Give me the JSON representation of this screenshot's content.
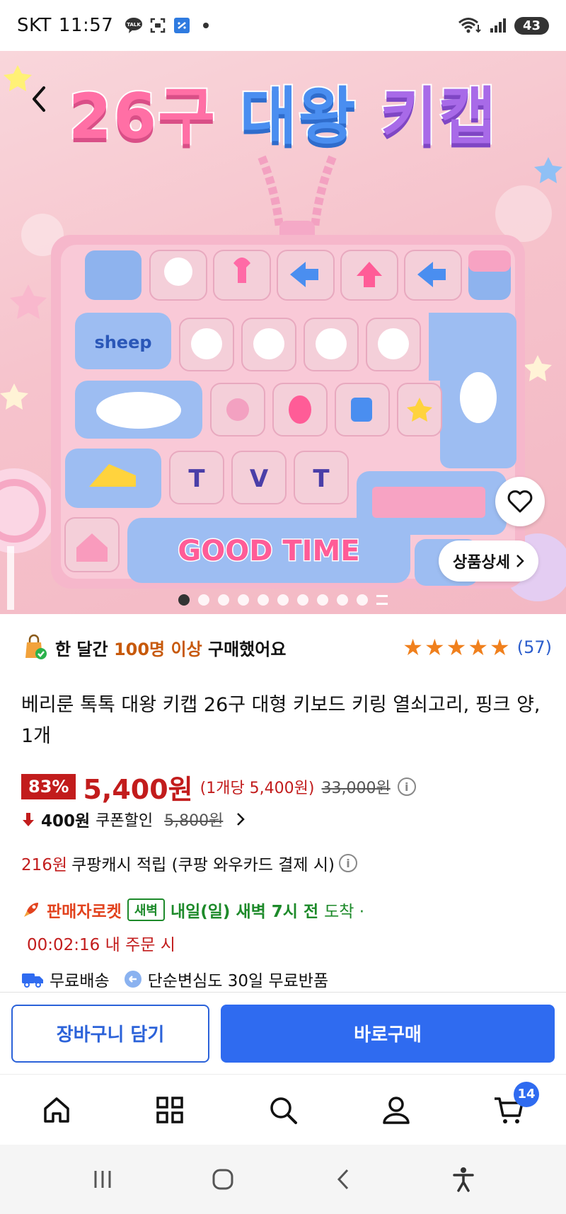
{
  "status_bar": {
    "carrier": "SKT",
    "time": "11:57",
    "talk_icon_text": "TALK",
    "battery": "43"
  },
  "hero": {
    "title_part1": "26구",
    "title_part2": "대왕",
    "title_part3": "키캡",
    "key_text_sheep": "sheep",
    "key_text_goodtime": "GOOD TIME",
    "key_letters": [
      "T",
      "V",
      "T"
    ],
    "detail_button_label": "상품상세",
    "image_count": 10,
    "current_image": 1
  },
  "social_proof": {
    "prefix": "한 달간 ",
    "highlight": "100명 이상",
    "suffix": " 구매했어요",
    "rating": 5,
    "review_count": "(57)"
  },
  "product": {
    "title": "베리룬 톡톡 대왕 키캡 26구 대형 키보드 키링 열쇠고리, 핑크 양, 1개"
  },
  "price": {
    "discount": "83%",
    "sale_price": "5,400원",
    "unit_price": "(1개당 5,400원)",
    "original_price": "33,000원"
  },
  "coupon": {
    "amount": "400원",
    "label": "쿠폰할인",
    "pre_coupon_price": "5,800원"
  },
  "cash": {
    "amount": "216원",
    "label": "쿠팡캐시 적립 (쿠팡 와우카드 결제 시)"
  },
  "delivery": {
    "rocket_label": "판매자로켓",
    "dawn_badge": "새벽",
    "arrival": "내일(일) 새벽 7시 전",
    "arrival_suffix": "도착 ·",
    "countdown": "00:02:16 내 주문 시"
  },
  "benefits": {
    "free_shipping": "무료배송",
    "free_return": "단순변심도 30일 무료반품"
  },
  "actions": {
    "cart_label": "장바구니 담기",
    "buy_label": "바로구매"
  },
  "tab_bar": {
    "cart_count": "14"
  },
  "colors": {
    "accent_blue": "#2f6bf0",
    "price_red": "#c21c1c",
    "dawn_green": "#1d8a2a",
    "star_orange": "#f0801d"
  }
}
